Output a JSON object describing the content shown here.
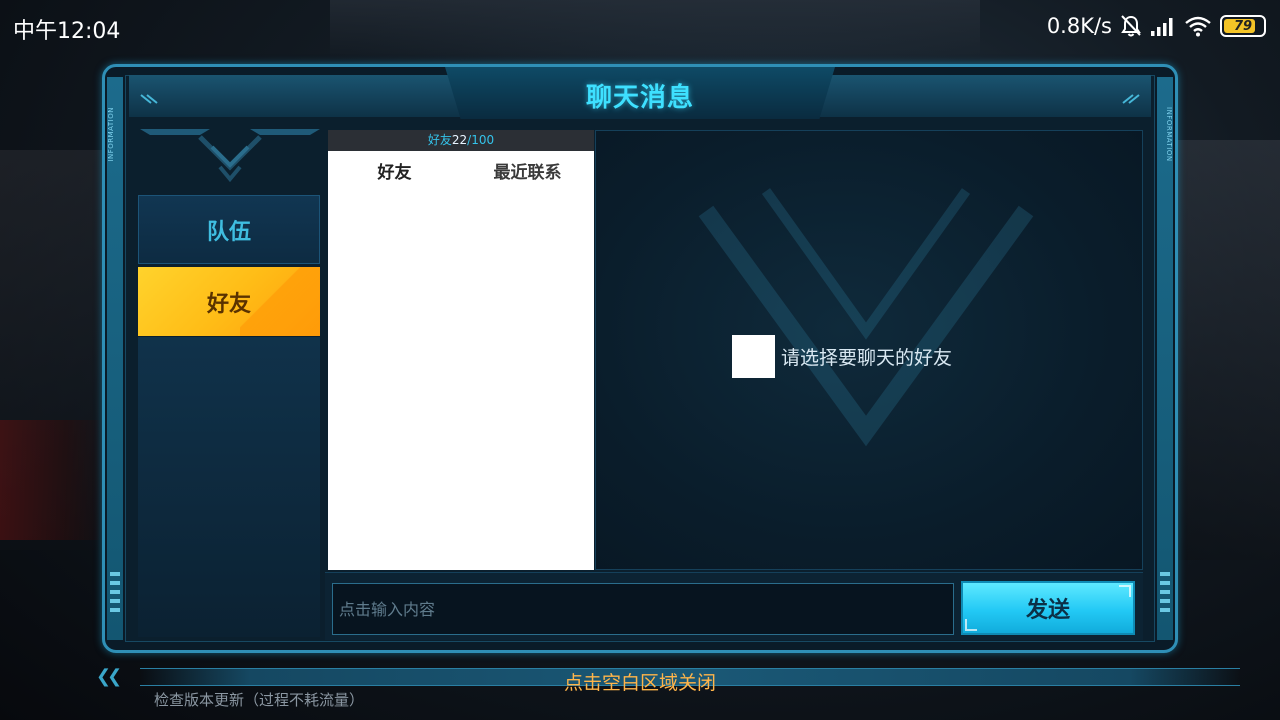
{
  "status_bar": {
    "time": "中午12:04",
    "network_speed": "0.8K/s",
    "battery_level": "79",
    "icons": [
      "bell-muted-icon",
      "signal-icon",
      "wifi-icon",
      "battery-icon"
    ]
  },
  "dialog": {
    "title": "聊天消息",
    "side_label": "INFORMATION"
  },
  "nav": {
    "team_label": "队伍",
    "friends_label": "好友",
    "active": "friends"
  },
  "friend_list": {
    "count_label": "好友",
    "count_current": "22",
    "count_max": "/100",
    "tabs": [
      "好友",
      "最近联系"
    ]
  },
  "chat": {
    "empty_hint": "请选择要聊天的好友"
  },
  "input": {
    "placeholder": "点击输入内容",
    "send_label": "发送"
  },
  "footer": {
    "close_hint": "点击空白区域关闭",
    "update_text": "检查版本更新（过程不耗流量）"
  },
  "colors": {
    "accent": "#3ee0ff",
    "active_tab": "#ffc21d",
    "send_button": "#23c9f5",
    "close_hint": "#ffb54a"
  }
}
